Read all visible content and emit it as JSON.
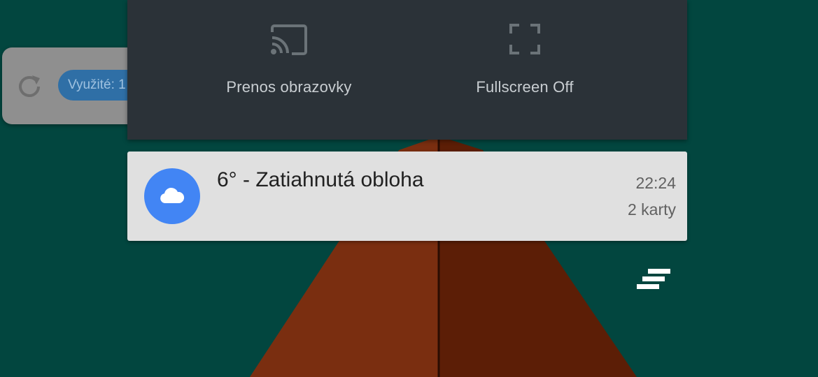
{
  "background": {
    "teal": "#02463f",
    "wood_light": "#7a2e10",
    "wood_dark": "#5c1e06"
  },
  "background_widget": {
    "usage_label": "Využité: 1",
    "refresh_icon": "refresh-icon"
  },
  "quick_settings": {
    "tiles": [
      {
        "label": "Prenos obrazovky",
        "icon": "cast-icon"
      },
      {
        "label": "Fullscreen Off",
        "icon": "fullscreen-icon"
      }
    ]
  },
  "notification": {
    "icon": "cloud-icon",
    "accent": "#4285f4",
    "title": "6° - Zatiahnutá obloha",
    "time": "22:24",
    "subtext": "2 karty"
  },
  "app_menu": {
    "icon": "stacked-lines-icon"
  }
}
